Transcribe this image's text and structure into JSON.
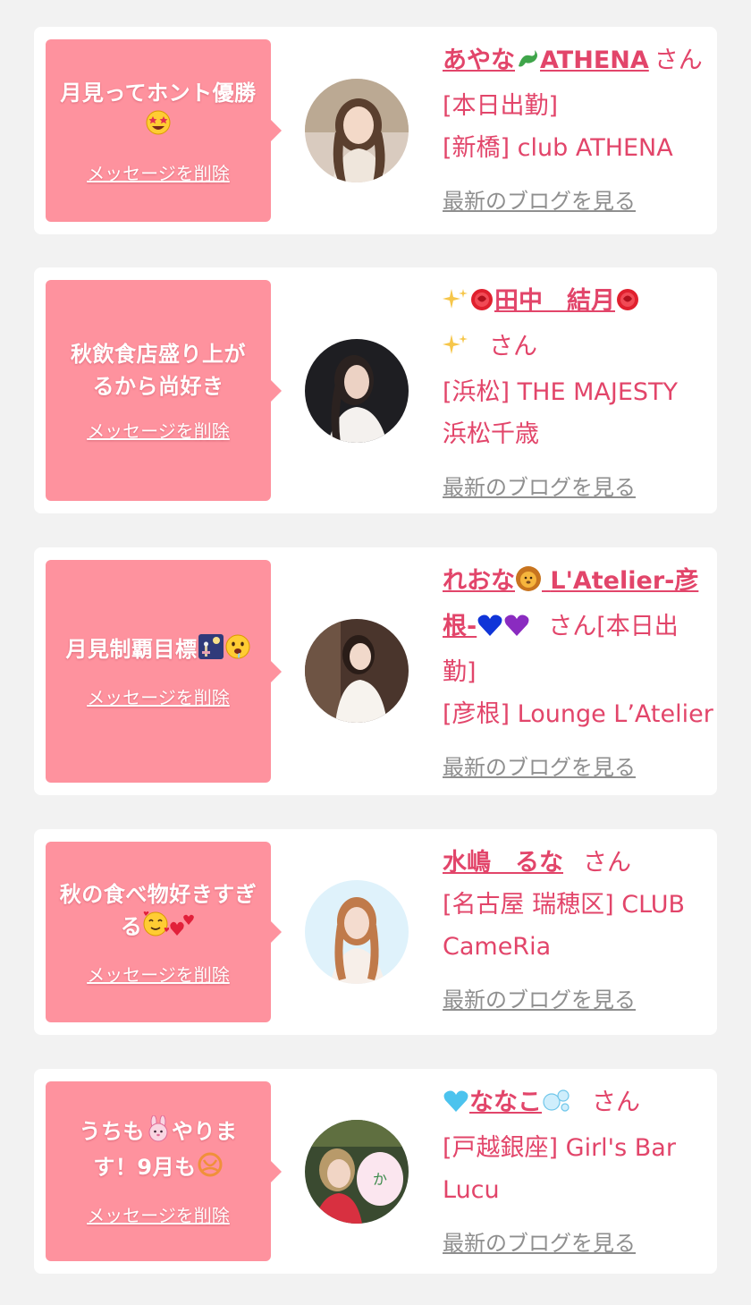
{
  "delete_label": "メッセージを削除",
  "blog_label": "最新のブログを見る",
  "san_label": "さん",
  "colors": {
    "page_bg": "#f2f2f2",
    "bubble": "#fe929e",
    "accent": "#e2456a",
    "blog_link": "#8f8f8f"
  },
  "cards": [
    {
      "message_parts": [
        "月見ってホント優勝"
      ],
      "message_emoji": [
        "star-struck-emoji"
      ],
      "name": "あやな",
      "name_tail": "ATHENA",
      "name_emoji": [
        "dragon-emoji"
      ],
      "san_suffix": "[本日出勤]",
      "store": "[新橋] club ATHENA"
    },
    {
      "message_parts": [
        "秋飲食店盛り上がるから尚好き"
      ],
      "name": "田中　結月",
      "name_emoji": [
        "sparkles-emoji",
        "rose-emoji"
      ],
      "store": "[浜松] THE MAJESTY 浜松千歳"
    },
    {
      "message_parts": [
        "月見制覇目標"
      ],
      "message_emoji": [
        "moon-viewing-emoji",
        "drooling-face-emoji"
      ],
      "name": "れおな",
      "name_tail": "L'Atelier-彦根-",
      "name_emoji": [
        "lion-emoji",
        "blue-heart-emoji",
        "purple-heart-emoji"
      ],
      "san_suffix": "[本日出勤]",
      "store": "[彦根] Lounge L’Atelier"
    },
    {
      "message_parts": [
        "秋の食べ物好きすぎる"
      ],
      "message_emoji": [
        "smiling-hearts-emoji",
        "two-hearts-emoji"
      ],
      "name": "水嶋　るな",
      "store": "[名古屋 瑞穂区] CLUB CameRia"
    },
    {
      "message_parts": [
        "うちも",
        "やります！9月も"
      ],
      "message_emoji": [
        "rabbit-emoji",
        "love-letter-emoji"
      ],
      "name": "ななこ",
      "name_emoji": [
        "light-blue-heart-emoji",
        "bubbles-emoji"
      ],
      "store": "[戸越銀座] Girl's Bar Lucu"
    }
  ]
}
